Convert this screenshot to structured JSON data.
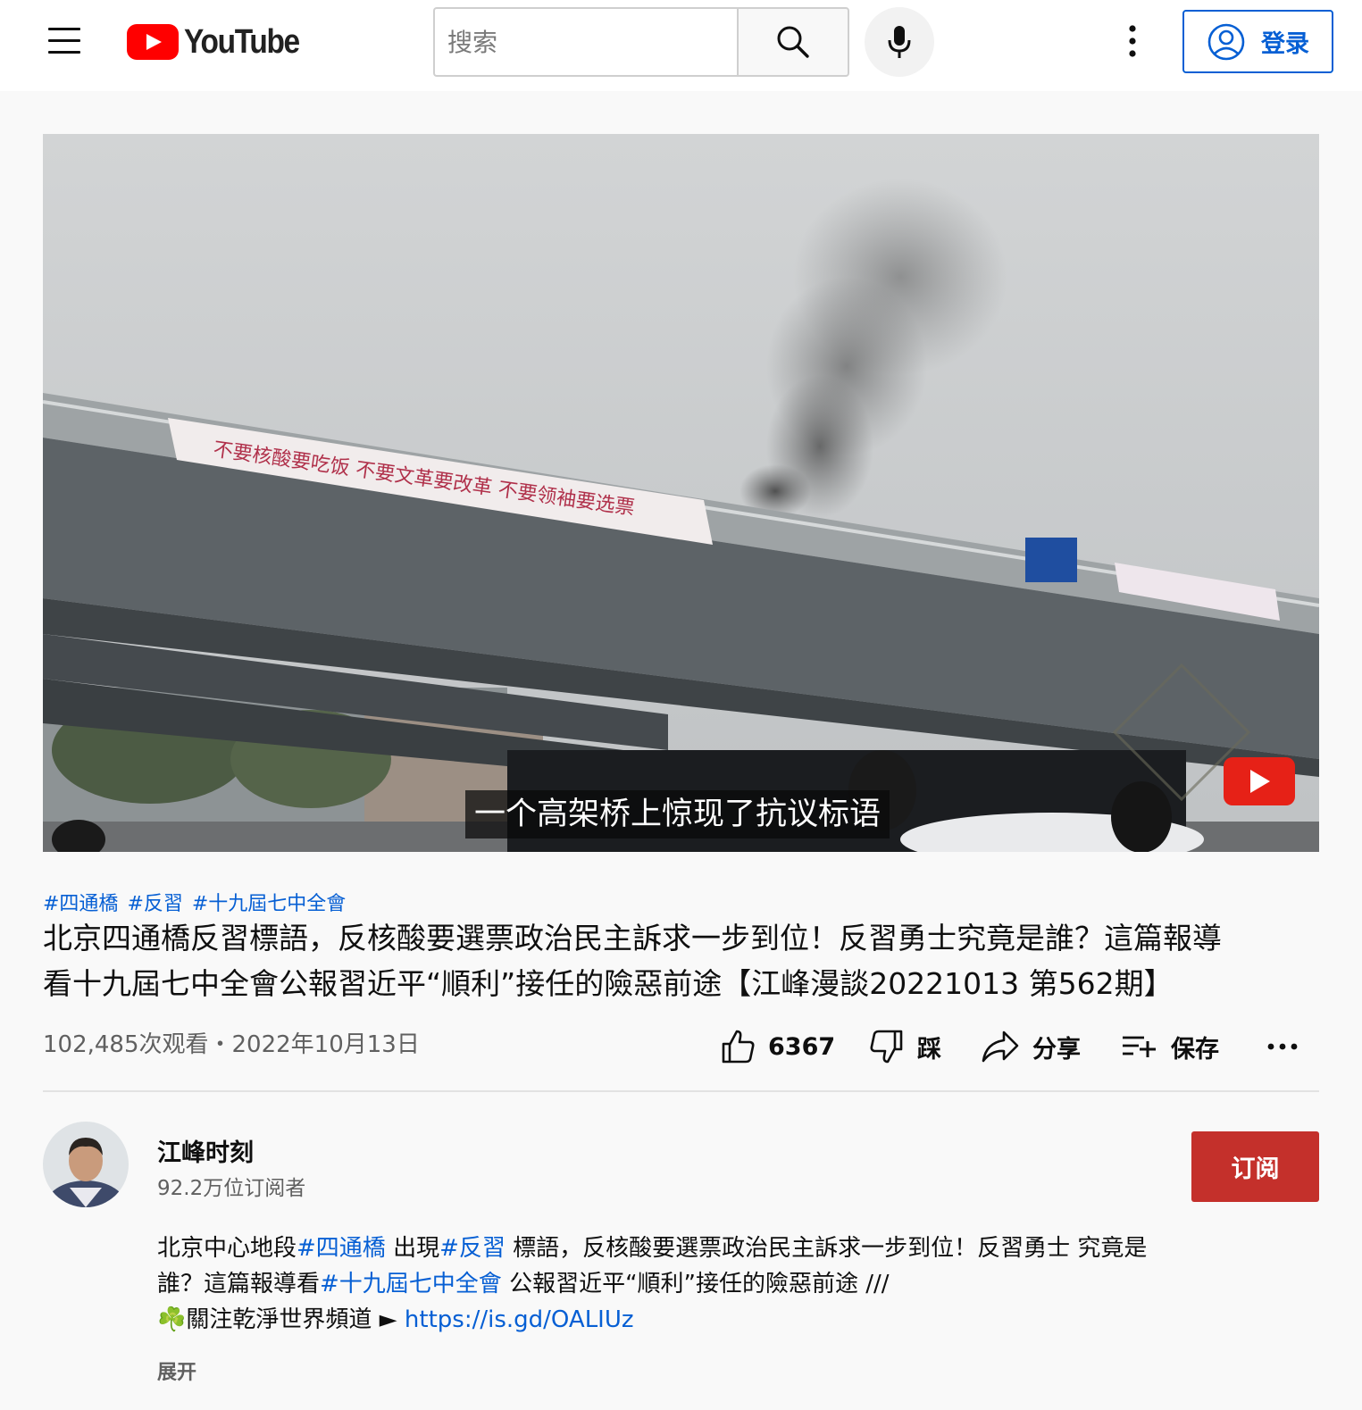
{
  "header": {
    "logo_text": "YouTube",
    "search_placeholder": "搜索",
    "signin_label": "登录"
  },
  "video": {
    "caption": "一个高架桥上惊现了抗议标语"
  },
  "hashtags": [
    "#四通橋",
    "#反習",
    "#十九屆七中全會"
  ],
  "title_lines": [
    "北京四通橋反習標語，反核酸要選票政治民主訴求一步到位！反習勇士究竟是誰？這篇報導",
    "看十九屆七中全會公報習近平“順利”接任的險惡前途【江峰漫談20221013 第562期】"
  ],
  "views_date": "102,485次观看・2022年10月13日",
  "actions": {
    "like_count": "6367",
    "dislike_label": "踩",
    "share_label": "分享",
    "save_label": "保存"
  },
  "channel": {
    "name": "江峰时刻",
    "subscribers": "92.2万位订阅者",
    "subscribe_label": "订阅"
  },
  "description": {
    "line1_a": "北京中心地段",
    "line1_tag1": "#四通橋",
    "line1_b": " 出現",
    "line1_tag2": "#反習",
    "line1_c": " 標語，反核酸要選票政治民主訴求一步到位！反習勇士 究竟是",
    "line2_a": "誰？這篇報導看",
    "line2_tag": "#十九屆七中全會",
    "line2_b": " 公報習近平“順利”接任的險惡前途 ///",
    "line3_icon": "☘️",
    "line3_a": "關注乾淨世界頻道 ► ",
    "line3_link": "https://is.gd/OALIUz",
    "expand_label": "展开"
  },
  "colors": {
    "accent_blue": "#065fd4",
    "brand_red": "#ff0000",
    "subscribe_red": "#c4302b"
  }
}
